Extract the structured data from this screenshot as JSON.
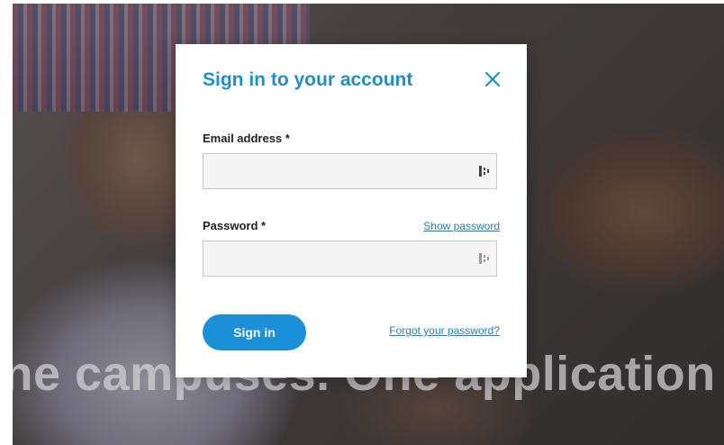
{
  "background": {
    "tagline": "ine campuses. One application"
  },
  "modal": {
    "title": "Sign in to your account",
    "close_icon": "close-icon",
    "email": {
      "label": "Email address *",
      "value": "",
      "placeholder": ""
    },
    "password": {
      "label": "Password *",
      "value": "",
      "placeholder": "",
      "show_password_label": "Show password"
    },
    "signin_label": "Sign in",
    "forgot_password_label": "Forgot your password?"
  },
  "colors": {
    "accent": "#1b8fd8",
    "link": "#1c7fc2",
    "title": "#1c8fd4"
  }
}
